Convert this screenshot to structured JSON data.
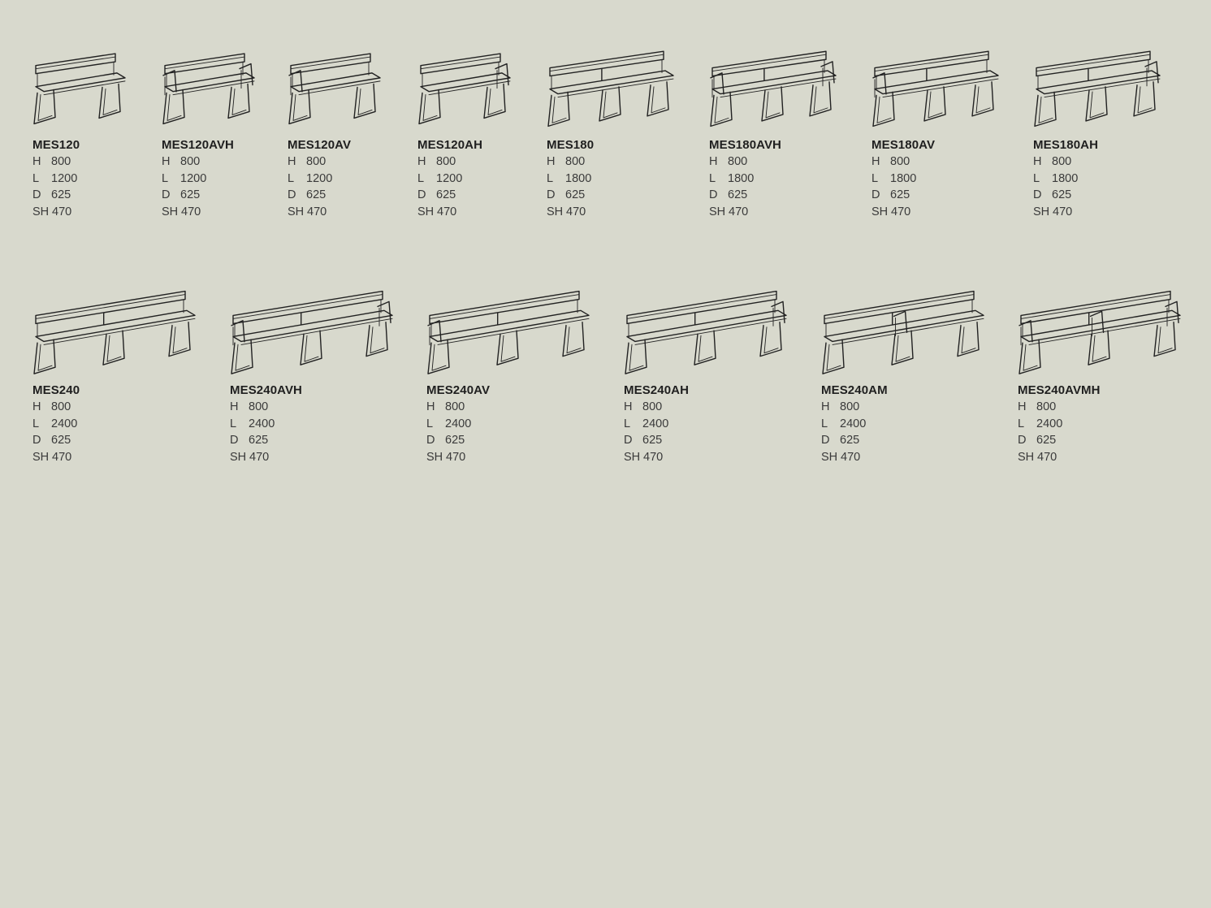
{
  "rows": [
    [
      {
        "model": "MES120",
        "H": "800",
        "L": "1200",
        "D": "625",
        "SH": "470",
        "length": 1200,
        "arms": "none",
        "mid_arm": false
      },
      {
        "model": "MES120AVH",
        "H": "800",
        "L": "1200",
        "D": "625",
        "SH": "470",
        "length": 1200,
        "arms": "both",
        "mid_arm": false
      },
      {
        "model": "MES120AV",
        "H": "800",
        "L": "1200",
        "D": "625",
        "SH": "470",
        "length": 1200,
        "arms": "left",
        "mid_arm": false
      },
      {
        "model": "MES120AH",
        "H": "800",
        "L": "1200",
        "D": "625",
        "SH": "470",
        "length": 1200,
        "arms": "right",
        "mid_arm": false
      },
      {
        "model": "MES180",
        "H": "800",
        "L": "1800",
        "D": "625",
        "SH": "470",
        "length": 1800,
        "arms": "none",
        "mid_arm": false
      },
      {
        "model": "MES180AVH",
        "H": "800",
        "L": "1800",
        "D": "625",
        "SH": "470",
        "length": 1800,
        "arms": "both",
        "mid_arm": false
      },
      {
        "model": "MES180AV",
        "H": "800",
        "L": "1800",
        "D": "625",
        "SH": "470",
        "length": 1800,
        "arms": "left",
        "mid_arm": false
      },
      {
        "model": "MES180AH",
        "H": "800",
        "L": "1800",
        "D": "625",
        "SH": "470",
        "length": 1800,
        "arms": "right",
        "mid_arm": false
      }
    ],
    [
      {
        "model": "MES240",
        "H": "800",
        "L": "2400",
        "D": "625",
        "SH": "470",
        "length": 2400,
        "arms": "none",
        "mid_arm": false
      },
      {
        "model": "MES240AVH",
        "H": "800",
        "L": "2400",
        "D": "625",
        "SH": "470",
        "length": 2400,
        "arms": "both",
        "mid_arm": false
      },
      {
        "model": "MES240AV",
        "H": "800",
        "L": "2400",
        "D": "625",
        "SH": "470",
        "length": 2400,
        "arms": "left",
        "mid_arm": false
      },
      {
        "model": "MES240AH",
        "H": "800",
        "L": "2400",
        "D": "625",
        "SH": "470",
        "length": 2400,
        "arms": "right",
        "mid_arm": false
      },
      {
        "model": "MES240AM",
        "H": "800",
        "L": "2400",
        "D": "625",
        "SH": "470",
        "length": 2400,
        "arms": "none",
        "mid_arm": true
      },
      {
        "model": "MES240AVMH",
        "H": "800",
        "L": "2400",
        "D": "625",
        "SH": "470",
        "length": 2400,
        "arms": "both",
        "mid_arm": true
      }
    ]
  ],
  "spec_labels": {
    "H": "H",
    "L": "L",
    "D": "D",
    "SH": "SH"
  },
  "colors": {
    "background": "#d8d9cd",
    "line": "#222222",
    "text": "#2b2b2b"
  }
}
